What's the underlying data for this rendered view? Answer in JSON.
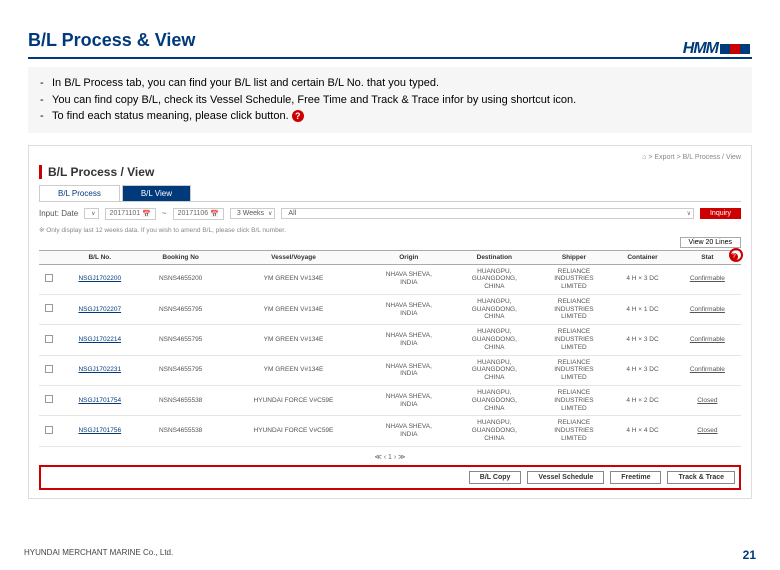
{
  "logo": "HMM",
  "title": "B/L Process & View",
  "bullets": [
    "In B/L Process tab, you can find your B/L list and certain B/L No. that you typed.",
    "You can find copy B/L, check its Vessel Schedule, Free Time and Track & Trace infor by using shortcut icon.",
    "To find each status meaning, please click      button."
  ],
  "breadcrumb": "⌂ > Export > B/L Process / View",
  "panelTitle": "B/L Process / View",
  "tabs": {
    "process": "B/L Process",
    "view": "B/L View"
  },
  "filters": {
    "label": "Input: Date",
    "from": "20171101",
    "to": "20171106",
    "weeks": "3 Weeks",
    "all": "All",
    "inquiry": "Inquiry"
  },
  "tableNote": "※ Only display last 12 weeks data. If you wish to amend B/L, please click B/L number.",
  "viewBtn": "View 20 Lines",
  "headers": [
    "",
    "B/L No.",
    "Booking No",
    "Vessel/Voyage",
    "Origin",
    "Destination",
    "Shipper",
    "Container",
    "Stat"
  ],
  "rows": [
    {
      "bl": "NSGJ1702200",
      "bk": "NSNS4655200",
      "vv": "YM GREEN V#134E",
      "org": "NHAVA SHEVA,\nINDIA",
      "dst": "HUANGPU,\nGUANGDONG,\nCHINA",
      "shp": "RELIANCE\nINDUSTRIES\nLIMITED",
      "cnt": "4 H × 3 DC",
      "st": "Confirmable"
    },
    {
      "bl": "NSGJ1702207",
      "bk": "NSNS4655795",
      "vv": "YM GREEN V#134E",
      "org": "NHAVA SHEVA,\nINDIA",
      "dst": "HUANGPU,\nGUANGDONG,\nCHINA",
      "shp": "RELIANCE\nINDUSTRIES\nLIMITED",
      "cnt": "4 H × 1 DC",
      "st": "Confirmable"
    },
    {
      "bl": "NSGJ1702214",
      "bk": "NSNS4655795",
      "vv": "YM GREEN V#134E",
      "org": "NHAVA SHEVA,\nINDIA",
      "dst": "HUANGPU,\nGUANGDONG,\nCHINA",
      "shp": "RELIANCE\nINDUSTRIES\nLIMITED",
      "cnt": "4 H × 3 DC",
      "st": "Confirmable"
    },
    {
      "bl": "NSGJ1702231",
      "bk": "NSNS4655795",
      "vv": "YM GREEN V#134E",
      "org": "NHAVA SHEVA,\nINDIA",
      "dst": "HUANGPU,\nGUANGDONG,\nCHINA",
      "shp": "RELIANCE\nINDUSTRIES\nLIMITED",
      "cnt": "4 H × 3 DC",
      "st": "Confirmable"
    },
    {
      "bl": "NSGJ1701754",
      "bk": "NSNS4655538",
      "vv": "HYUNDAI FORCE V#C59E",
      "org": "NHAVA SHEVA,\nINDIA",
      "dst": "HUANGPU,\nGUANGDONG,\nCHINA",
      "shp": "RELIANCE\nINDUSTRIES\nLIMITED",
      "cnt": "4 H × 2 DC",
      "st": "Closed"
    },
    {
      "bl": "NSGJ1701756",
      "bk": "NSNS4655538",
      "vv": "HYUNDAI FORCE V#C59E",
      "org": "NHAVA SHEVA,\nINDIA",
      "dst": "HUANGPU,\nGUANGDONG,\nCHINA",
      "shp": "RELIANCE\nINDUSTRIES\nLIMITED",
      "cnt": "4 H × 4 DC",
      "st": "Closed"
    }
  ],
  "pager": "≪  ‹  1  ›  ≫",
  "bottomButtons": [
    "B/L Copy",
    "Vessel Schedule",
    "Freetime",
    "Track & Trace"
  ],
  "footerCo": "HYUNDAI MERCHANT MARINE Co., Ltd.",
  "pageNum": "21"
}
